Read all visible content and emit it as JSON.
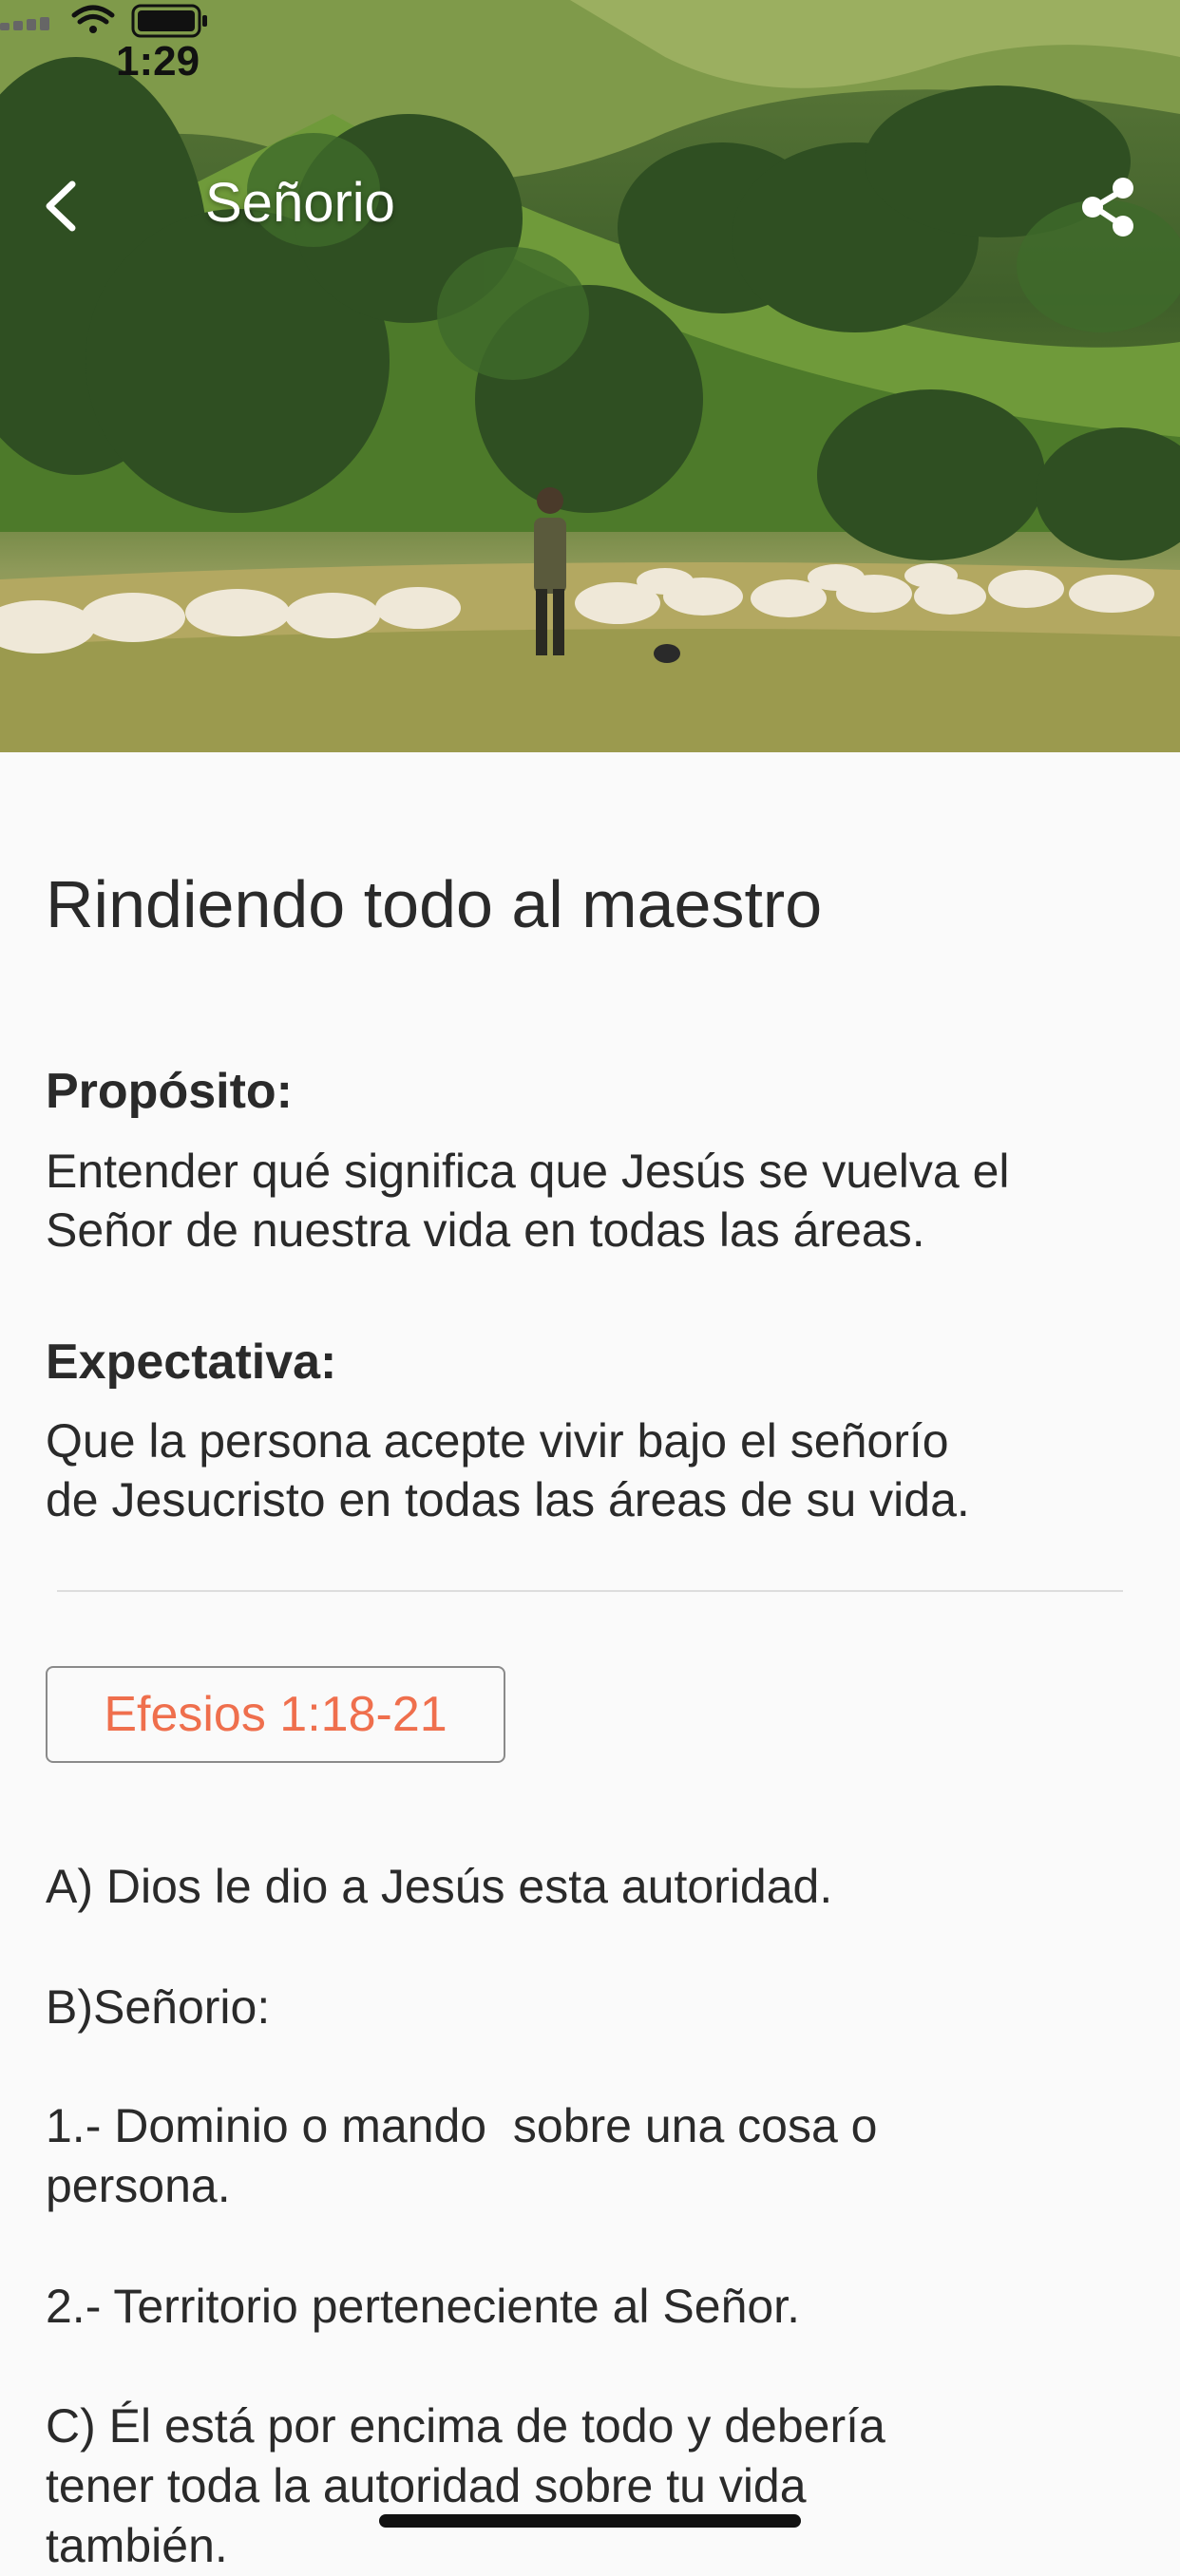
{
  "status_bar": {
    "time": "1:29"
  },
  "nav": {
    "title": "Señorio",
    "back_icon": "chevron-left-icon",
    "share_icon": "share-icon"
  },
  "lesson": {
    "title": "Rindiendo todo al maestro",
    "purpose_label": "Propósito:",
    "purpose_lines": [
      "Entender qué significa que Jesús se vuelva el",
      "Señor de nuestra vida en todas las áreas."
    ],
    "expectation_label": "Expectativa:",
    "expectation_lines": [
      "Que la persona acepte vivir bajo el señorío",
      "de Jesucristo en todas las áreas de su vida."
    ],
    "reference_button": "Efesios 1:18-21",
    "body": [
      "A) Dios le dio a Jesús esta autoridad.",
      "B)Señorio:",
      "1.- Dominio o mando  sobre una cosa o",
      "persona.",
      "2.- Territorio perteneciente al Señor.",
      "C) Él está por encima de todo y debería",
      "tener toda la autoridad sobre tu vida",
      "también."
    ]
  },
  "colors": {
    "accent": "#ef6f4d",
    "background": "#fafafa",
    "text": "#2a2a2a"
  }
}
